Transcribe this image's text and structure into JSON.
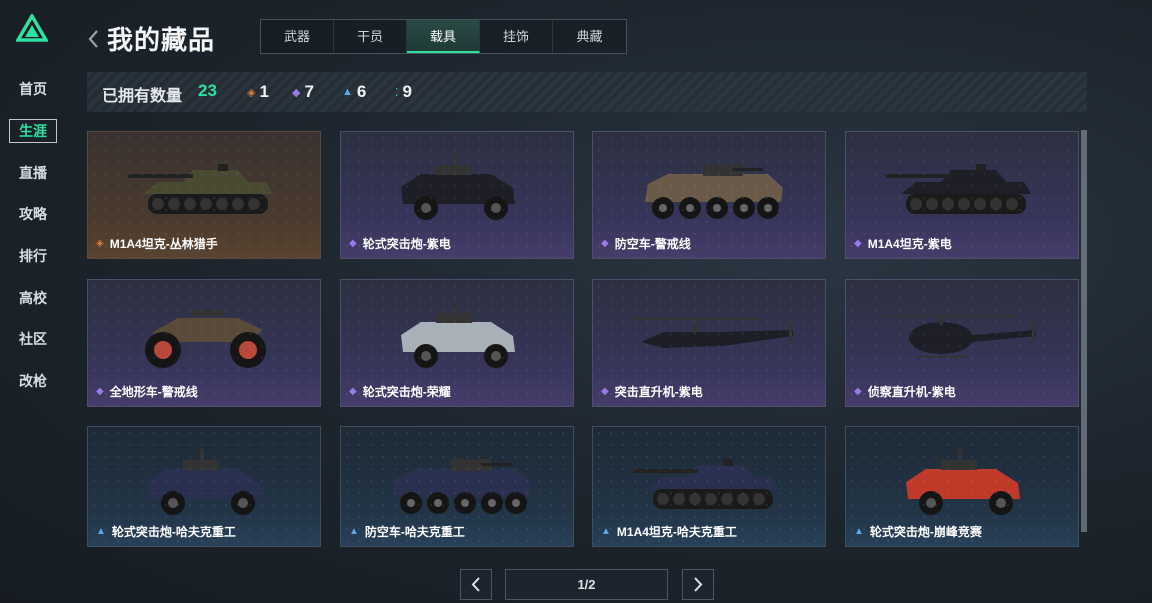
{
  "sidebar": {
    "items": [
      {
        "label": "首页",
        "active": false
      },
      {
        "label": "生涯",
        "active": true
      },
      {
        "label": "直播",
        "active": false
      },
      {
        "label": "攻略",
        "active": false
      },
      {
        "label": "排行",
        "active": false
      },
      {
        "label": "高校",
        "active": false
      },
      {
        "label": "社区",
        "active": false
      },
      {
        "label": "改枪",
        "active": false
      }
    ]
  },
  "header": {
    "title": "我的藏品",
    "tabs": [
      {
        "label": "武器",
        "active": false
      },
      {
        "label": "干员",
        "active": false
      },
      {
        "label": "载具",
        "active": true
      },
      {
        "label": "挂饰",
        "active": false
      },
      {
        "label": "典藏",
        "active": false
      }
    ]
  },
  "stats": {
    "owned_label": "已拥有数量",
    "total": "23",
    "rarities": [
      {
        "icon": "orange-diamond-icon",
        "color": "#e07a3a",
        "count": "1"
      },
      {
        "icon": "purple-diamond-icon",
        "color": "#9a7ae8",
        "count": "7"
      },
      {
        "icon": "blue-chevron-icon",
        "color": "#5aa8e8",
        "count": "6"
      },
      {
        "icon": "green-dots-icon",
        "color": "#2fe0a0",
        "count": "9"
      }
    ]
  },
  "items": [
    {
      "name": "M1A4坦克-丛林猎手",
      "rarity": "orange",
      "vehicle": "tank"
    },
    {
      "name": "轮式突击炮-紫电",
      "rarity": "purple",
      "vehicle": "armored-car"
    },
    {
      "name": "防空车-警戒线",
      "rarity": "purple",
      "vehicle": "apc"
    },
    {
      "name": "M1A4坦克-紫电",
      "rarity": "purple",
      "vehicle": "tank"
    },
    {
      "name": "全地形车-警戒线",
      "rarity": "purple",
      "vehicle": "atv"
    },
    {
      "name": "轮式突击炮-荣耀",
      "rarity": "purple",
      "vehicle": "armored-car"
    },
    {
      "name": "突击直升机-紫电",
      "rarity": "purple",
      "vehicle": "attack-heli"
    },
    {
      "name": "侦察直升机-紫电",
      "rarity": "purple",
      "vehicle": "scout-heli"
    },
    {
      "name": "轮式突击炮-哈夫克重工",
      "rarity": "blue",
      "vehicle": "armored-car"
    },
    {
      "name": "防空车-哈夫克重工",
      "rarity": "blue",
      "vehicle": "apc"
    },
    {
      "name": "M1A4坦克-哈夫克重工",
      "rarity": "blue",
      "vehicle": "tank"
    },
    {
      "name": "轮式突击炮-崩峰竞赛",
      "rarity": "blue",
      "vehicle": "armored-car"
    }
  ],
  "pagination": {
    "page_text": "1/2"
  },
  "colors": {
    "accent": "#2fe0a0",
    "orange": "#e07a3a",
    "purple": "#9a7ae8",
    "blue": "#5aa8e8"
  }
}
